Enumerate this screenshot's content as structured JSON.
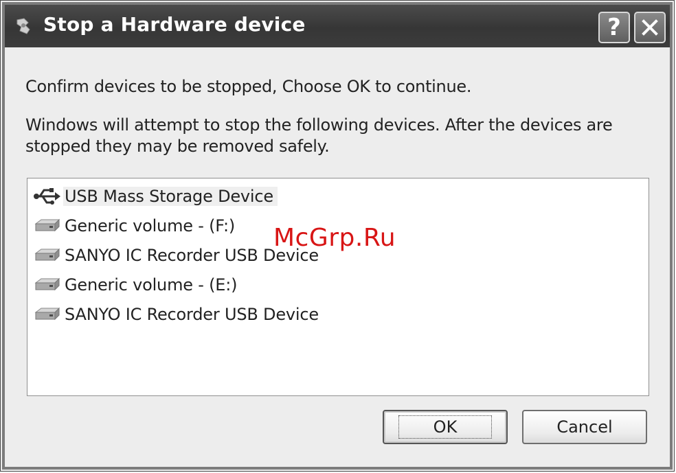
{
  "window": {
    "title": "Stop a Hardware device",
    "help_button": "?"
  },
  "message": {
    "line1": "Confirm devices to be stopped, Choose OK to continue.",
    "line2": "Windows will attempt to stop the following devices. After the devices are stopped they may be removed safely."
  },
  "devices": [
    {
      "label": "USB Mass Storage Device",
      "icon": "usb-icon",
      "selected": true
    },
    {
      "label": "Generic volume - (F:)",
      "icon": "drive-icon",
      "selected": false
    },
    {
      "label": "SANYO IC Recorder USB Device",
      "icon": "drive-icon",
      "selected": false
    },
    {
      "label": "Generic volume - (E:)",
      "icon": "drive-icon",
      "selected": false
    },
    {
      "label": "SANYO IC Recorder USB Device",
      "icon": "drive-icon",
      "selected": false
    }
  ],
  "buttons": {
    "ok": "OK",
    "cancel": "Cancel"
  },
  "watermark": "McGrp.Ru",
  "colors": {
    "titlebar": "#3c3c3c",
    "dialog_bg": "#ededed",
    "watermark": "#d81515"
  }
}
